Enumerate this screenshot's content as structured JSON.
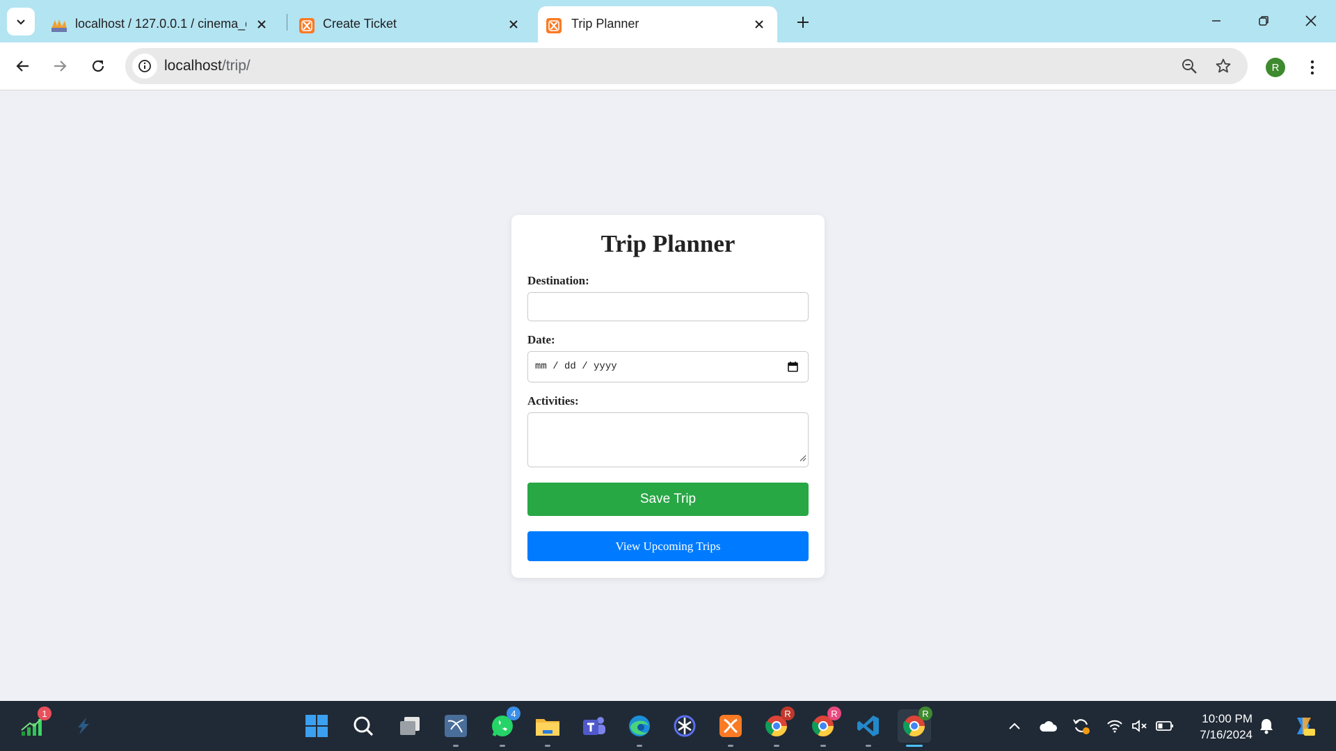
{
  "browser": {
    "tabs": [
      {
        "title": "localhost / 127.0.0.1 / cinema_d",
        "icon": "phpmyadmin-icon"
      },
      {
        "title": "Create Ticket",
        "icon": "xampp-icon"
      },
      {
        "title": "Trip Planner",
        "icon": "xampp-icon",
        "active": true
      }
    ],
    "url_host": "localhost",
    "url_path": "/trip/",
    "profile_initial": "R"
  },
  "page": {
    "title": "Trip Planner",
    "destination_label": "Destination:",
    "destination_value": "",
    "date_label": "Date:",
    "date_placeholder": "mm / dd / yyyy",
    "activities_label": "Activities:",
    "activities_value": "",
    "save_button": "Save Trip",
    "view_button": "View Upcoming Trips"
  },
  "taskbar": {
    "widgets_badge": "1",
    "whatsapp_badge": "4",
    "chrome_profile_badge_1": "R",
    "chrome_profile_badge_2": "R",
    "chrome_profile_badge_3": "R",
    "time": "10:00 PM",
    "date": "7/16/2024"
  },
  "colors": {
    "tabbar": "#b3e4f2",
    "save_button": "#28a745",
    "view_button": "#007bff",
    "taskbar": "#202a36"
  }
}
